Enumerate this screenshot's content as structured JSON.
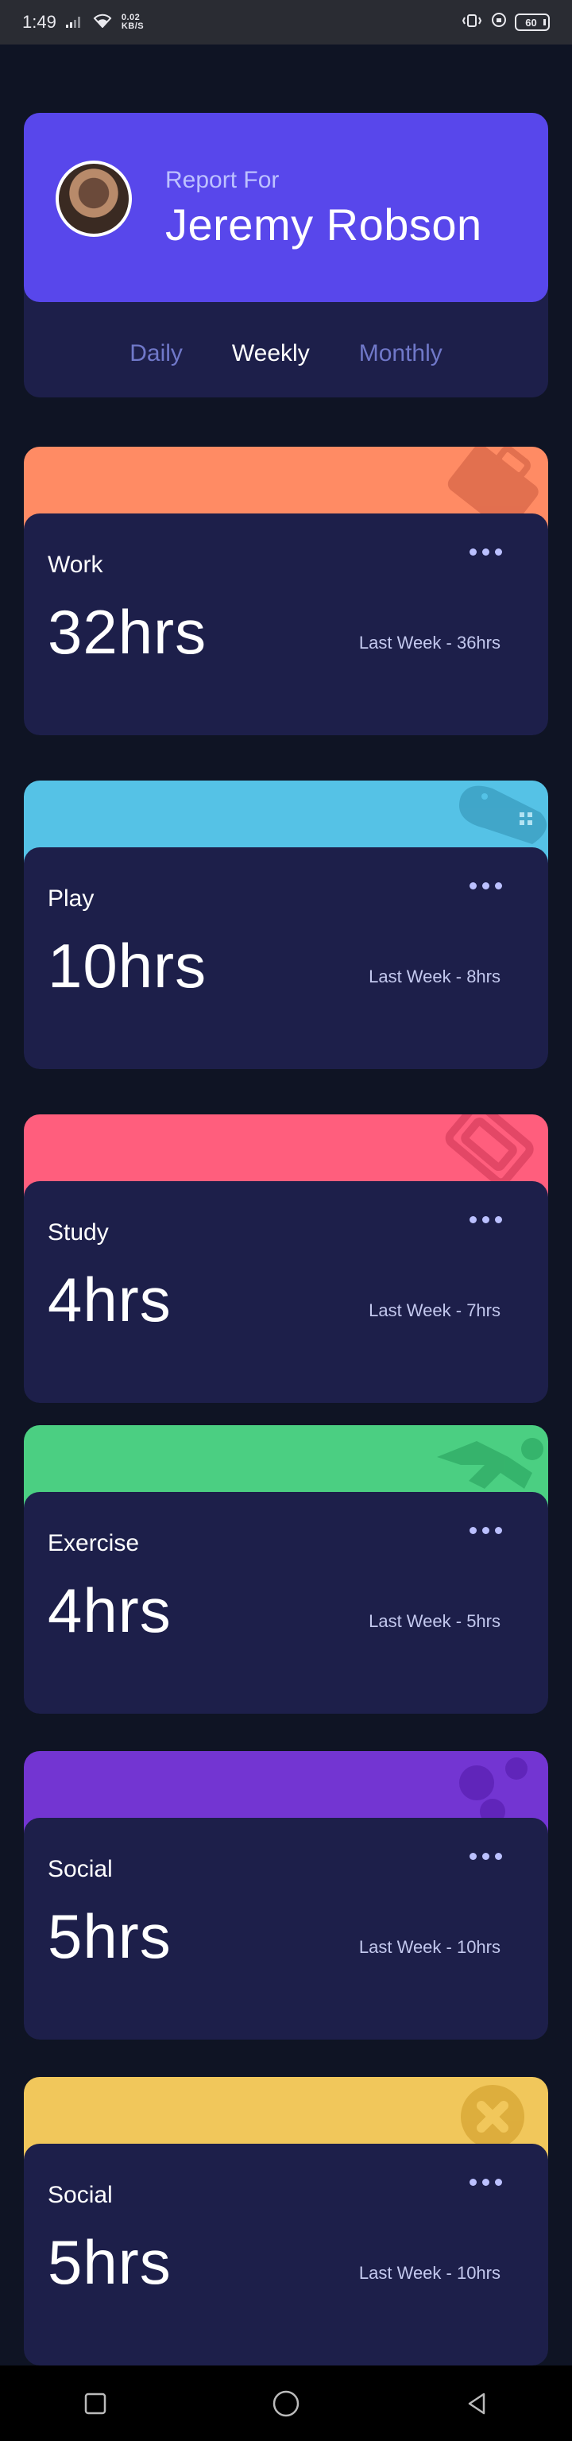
{
  "status_bar": {
    "time": "1:49",
    "net_speed_value": "0.02",
    "net_speed_unit": "KB/S",
    "battery": "60"
  },
  "profile": {
    "report_for_label": "Report For",
    "name": "Jeremy Robson",
    "tabs": [
      "Daily",
      "Weekly",
      "Monthly"
    ],
    "active_tab": "Weekly"
  },
  "cards": [
    {
      "title": "Work",
      "hours": "32hrs",
      "last": "Last Week - 36hrs",
      "color": "#ff8b64",
      "icon": "briefcase-icon"
    },
    {
      "title": "Play",
      "hours": "10hrs",
      "last": "Last Week - 8hrs",
      "color": "#55c2e6",
      "icon": "gamepad-icon"
    },
    {
      "title": "Study",
      "hours": "4hrs",
      "last": "Last Week - 7hrs",
      "color": "#ff5e7d",
      "icon": "book-icon"
    },
    {
      "title": "Exercise",
      "hours": "4hrs",
      "last": "Last Week - 5hrs",
      "color": "#4bcf82",
      "icon": "runner-icon"
    },
    {
      "title": "Social",
      "hours": "5hrs",
      "last": "Last Week - 10hrs",
      "color": "#7335d2",
      "icon": "social-icon"
    },
    {
      "title": "Social",
      "hours": "5hrs",
      "last": "Last Week - 10hrs",
      "color": "#f1c75b",
      "icon": "self-care-icon"
    }
  ],
  "nav": [
    "recent-apps-icon",
    "home-icon",
    "back-icon"
  ]
}
